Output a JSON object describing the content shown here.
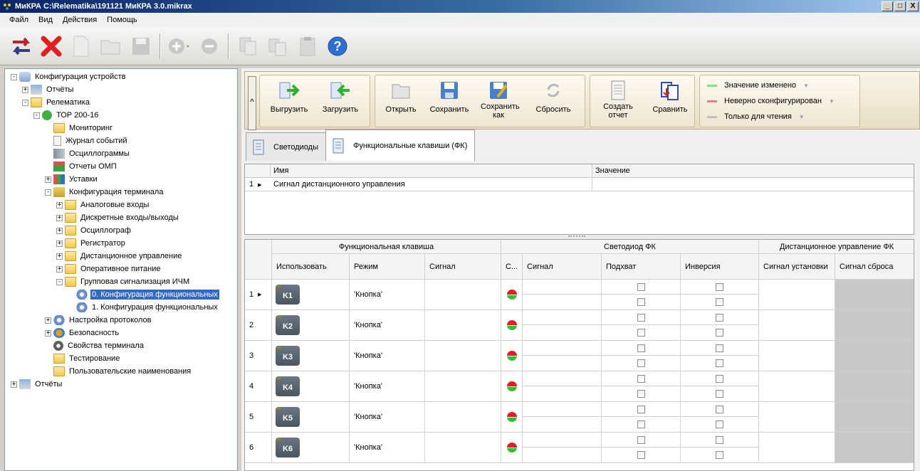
{
  "window": {
    "title": "МиКРА C:\\Relematika\\191121 МиКРА 3.0.mikrax",
    "controls": [
      "_",
      "□",
      "X"
    ]
  },
  "menu": [
    "Файл",
    "Вид",
    "Действия",
    "Помощь"
  ],
  "toolbar_icons": [
    "transfer-icon",
    "delete-icon",
    "new-doc-icon",
    "open-folder-icon",
    "save-icon",
    "add-icon",
    "remove-icon",
    "copy-icon",
    "paste-doc-icon",
    "clipboard-icon",
    "help-icon"
  ],
  "tree": [
    {
      "label": "Конфигурация устройств",
      "exp": "−"
    },
    {
      "label": "Отчёты",
      "exp": "+"
    },
    {
      "label": "Релематика",
      "exp": "−"
    },
    {
      "label": "ТОР 200-16",
      "exp": "−"
    },
    {
      "label": "Мониторинг",
      "exp": ""
    },
    {
      "label": "Журнал событий",
      "exp": ""
    },
    {
      "label": "Осциллограммы",
      "exp": ""
    },
    {
      "label": "Отчеты ОМП",
      "exp": ""
    },
    {
      "label": "Уставки",
      "exp": "+"
    },
    {
      "label": "Конфигурация терминала",
      "exp": "−"
    },
    {
      "label": "Аналоговые входы",
      "exp": "+"
    },
    {
      "label": "Дискретные входы/выходы",
      "exp": "+"
    },
    {
      "label": "Осциллограф",
      "exp": "+"
    },
    {
      "label": "Регистратор",
      "exp": "+"
    },
    {
      "label": "Дистанционное управление",
      "exp": "+"
    },
    {
      "label": "Оперативное питание",
      "exp": "+"
    },
    {
      "label": "Групповая сигнализация ИЧМ",
      "exp": "−"
    },
    {
      "label": "0. Конфигурация функциональных",
      "exp": "",
      "selected": true
    },
    {
      "label": "1. Конфигурация функциональных",
      "exp": ""
    },
    {
      "label": "Настройка протоколов",
      "exp": "+"
    },
    {
      "label": "Безопасность",
      "exp": "+"
    },
    {
      "label": "Свойства терминала",
      "exp": ""
    },
    {
      "label": "Тестирование",
      "exp": ""
    },
    {
      "label": "Пользовательские наименования",
      "exp": ""
    },
    {
      "label": "Отчёты",
      "exp": "+"
    }
  ],
  "ribbon": {
    "collapse": "^",
    "upload": "Выгрузить",
    "download": "Загрузить",
    "open": "Открыть",
    "save": "Сохранить",
    "save_as": "Сохранить как",
    "reset": "Сбросить",
    "report": "Создать отчет",
    "compare": "Сравнить",
    "legend": [
      {
        "label": "Значение изменено",
        "color": "#7ee07e"
      },
      {
        "label": "Неверно сконфигурирован",
        "color": "#f07878"
      },
      {
        "label": "Только для чтения",
        "color": "#c0c0c0"
      }
    ]
  },
  "tabs": [
    {
      "label": "Светодиоды"
    },
    {
      "label": "Функциональные клавиши (ФК)"
    }
  ],
  "upper_grid": {
    "headers": [
      "Имя",
      "Значение"
    ],
    "rows": [
      {
        "num": "1",
        "name": "Сигнал дистанционного управления",
        "value": ""
      }
    ]
  },
  "lower_grid": {
    "group_headers": [
      "Функциональная клавиша",
      "Светодиод ФК",
      "Дистанционное управление ФК"
    ],
    "headers": [
      "Использовать",
      "Режим",
      "Сигнал",
      "С...",
      "Сигнал",
      "Подхват",
      "Инверсия",
      "Сигнал установки",
      "Сигнал сброса"
    ],
    "rows": [
      {
        "num": "1",
        "key": "K1",
        "mode": "'Кнопка'"
      },
      {
        "num": "2",
        "key": "K2",
        "mode": "'Кнопка'"
      },
      {
        "num": "3",
        "key": "K3",
        "mode": "'Кнопка'"
      },
      {
        "num": "4",
        "key": "K4",
        "mode": "'Кнопка'"
      },
      {
        "num": "5",
        "key": "K5",
        "mode": "'Кнопка'"
      },
      {
        "num": "6",
        "key": "K6",
        "mode": "'Кнопка'"
      }
    ]
  }
}
